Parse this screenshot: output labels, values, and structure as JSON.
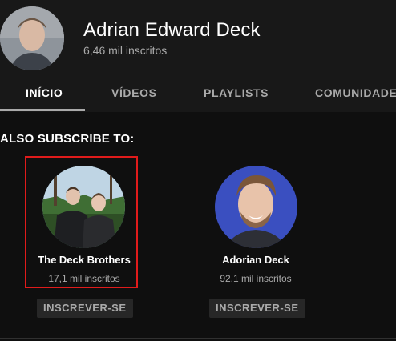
{
  "channel": {
    "name": "Adrian Edward Deck",
    "subscribers": "6,46 mil inscritos"
  },
  "tabs": [
    {
      "label": "INÍCIO",
      "active": true
    },
    {
      "label": "VÍDEOS",
      "active": false
    },
    {
      "label": "PLAYLISTS",
      "active": false
    },
    {
      "label": "COMUNIDADE",
      "active": false
    }
  ],
  "section": {
    "title": "ALSO SUBSCRIBE TO:"
  },
  "channels": [
    {
      "name": "The Deck Brothers",
      "subscribers": "17,1 mil inscritos",
      "button": "INSCREVER-SE",
      "highlighted": true
    },
    {
      "name": "Adorian Deck",
      "subscribers": "92,1 mil inscritos",
      "button": "INSCREVER-SE",
      "highlighted": false
    }
  ],
  "colors": {
    "background": "#181818",
    "content_background": "#0f0f0f",
    "highlight": "#e01b1b",
    "secondary_text": "#aaaaaa",
    "button_background": "#272727"
  }
}
